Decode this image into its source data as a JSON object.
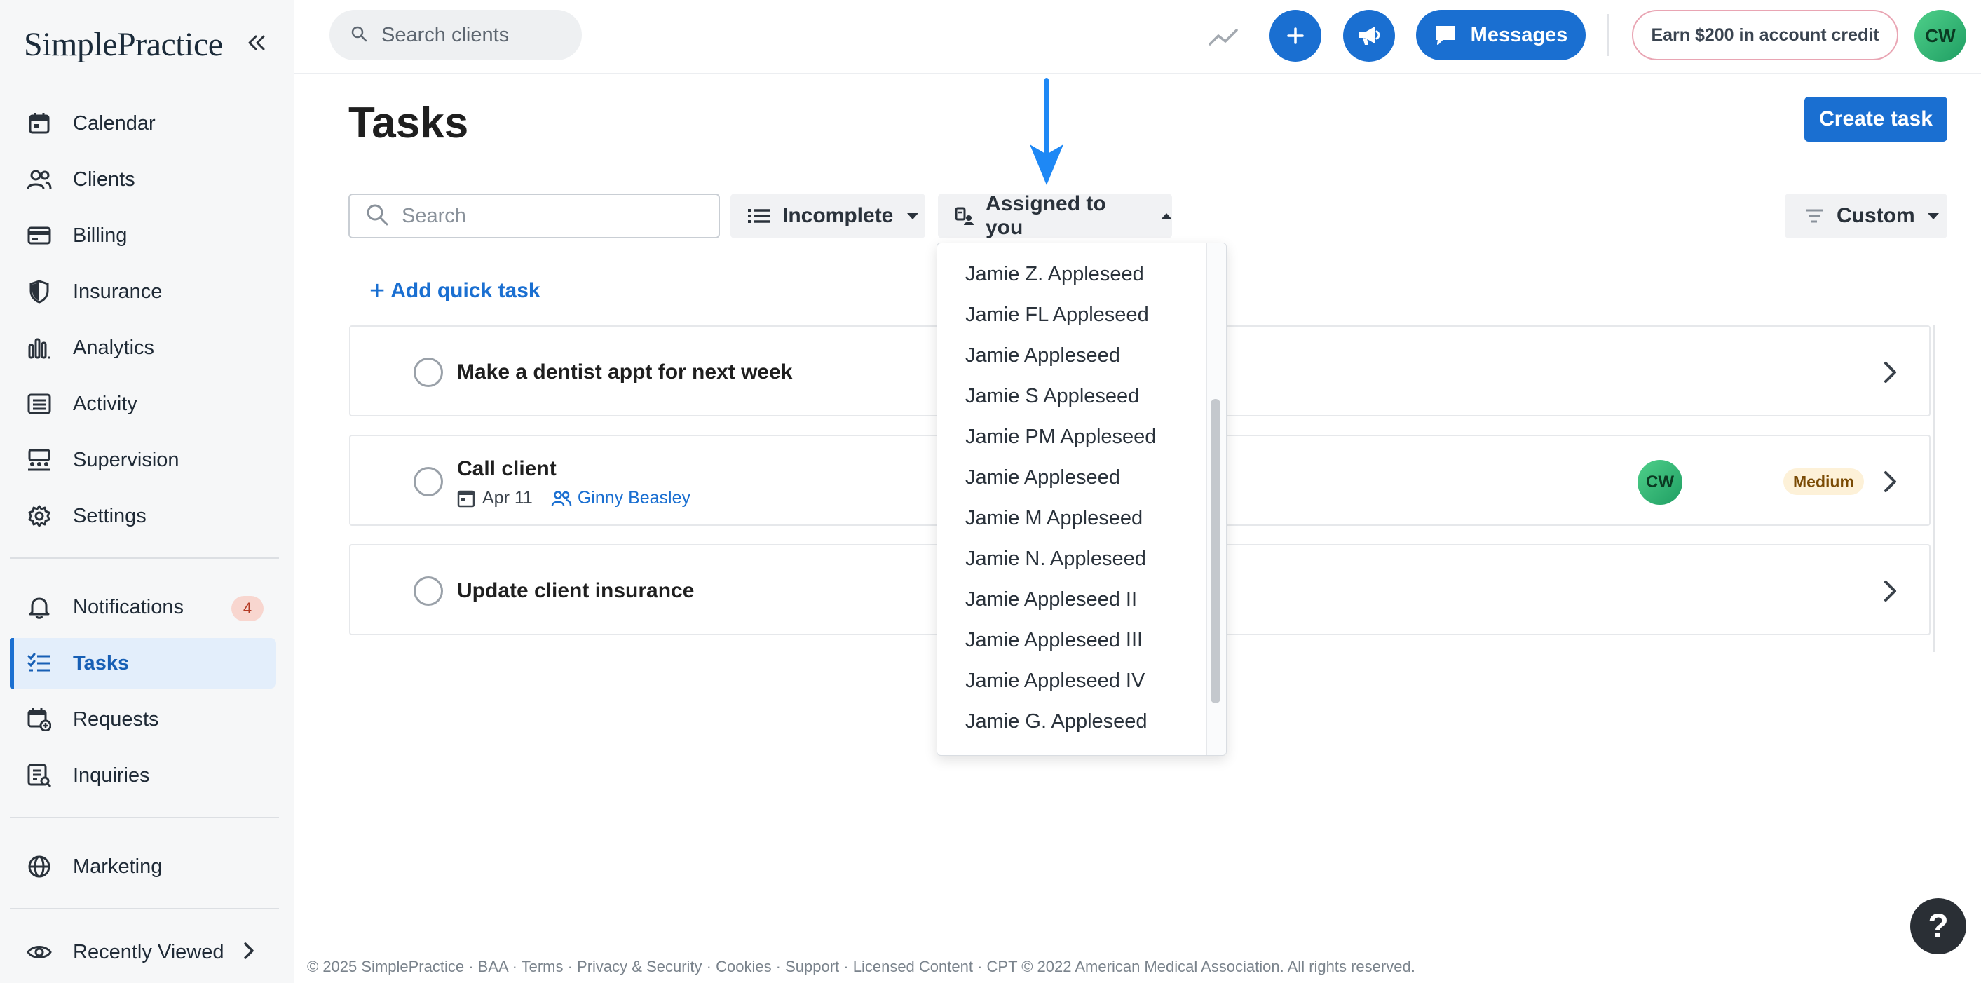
{
  "brand": {
    "name": "SimplePractice"
  },
  "sidebar": {
    "items": [
      {
        "label": "Calendar",
        "icon": "calendar-icon"
      },
      {
        "label": "Clients",
        "icon": "users-icon"
      },
      {
        "label": "Billing",
        "icon": "credit-card-icon"
      },
      {
        "label": "Insurance",
        "icon": "shield-icon"
      },
      {
        "label": "Analytics",
        "icon": "bar-chart-icon"
      },
      {
        "label": "Activity",
        "icon": "list-icon"
      },
      {
        "label": "Supervision",
        "icon": "supervision-icon"
      },
      {
        "label": "Settings",
        "icon": "gear-icon"
      }
    ],
    "items2": [
      {
        "label": "Notifications",
        "icon": "bell-icon",
        "badge": "4"
      },
      {
        "label": "Tasks",
        "icon": "tasks-icon",
        "active": true
      },
      {
        "label": "Requests",
        "icon": "calendar-plus-icon"
      },
      {
        "label": "Inquiries",
        "icon": "inquiries-icon"
      }
    ],
    "marketing": {
      "label": "Marketing",
      "icon": "globe-icon"
    },
    "recently_viewed": {
      "label": "Recently Viewed",
      "icon": "eye-icon"
    }
  },
  "topbar": {
    "search_placeholder": "Search clients",
    "messages_label": "Messages",
    "earn_label": "Earn $200 in account credit",
    "avatar_initials": "CW"
  },
  "main": {
    "title": "Tasks",
    "create_button": "Create task",
    "filters": {
      "search_placeholder": "Search",
      "status_label": "Incomplete",
      "assignee_label": "Assigned to you",
      "sort_label": "Custom"
    },
    "add_quick_task": "Add quick task",
    "tasks": [
      {
        "title": "Make a dentist appt for next week"
      },
      {
        "title": "Call client",
        "date": "Apr 11",
        "client": "Ginny Beasley",
        "assignee_initials": "CW",
        "priority": "Medium"
      },
      {
        "title": "Update client insurance"
      }
    ]
  },
  "dropdown": {
    "options": [
      "Jamie Z. Appleseed",
      "Jamie FL Appleseed",
      "Jamie Appleseed",
      "Jamie S Appleseed",
      "Jamie PM Appleseed",
      "Jamie Appleseed",
      "Jamie M Appleseed",
      "Jamie N. Appleseed",
      "Jamie Appleseed II",
      "Jamie Appleseed III",
      "Jamie Appleseed IV",
      "Jamie G. Appleseed"
    ]
  },
  "footer": {
    "text": "© 2025 SimplePractice · BAA · Terms · Privacy & Security · Cookies · Support · Licensed Content · CPT © 2022 American Medical Association. All rights reserved."
  },
  "help": {
    "label": "?"
  },
  "colors": {
    "accent": "#1a6fd1",
    "active_bg": "#e3eefb",
    "avatar": "#2fb571",
    "annotation_arrow": "#1e88f5"
  }
}
